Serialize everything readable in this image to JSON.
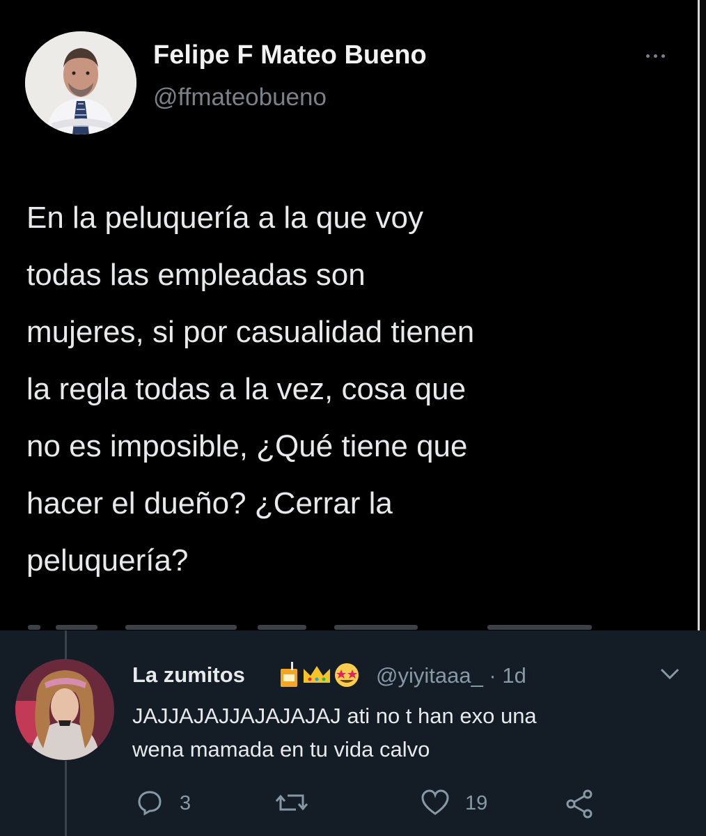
{
  "tweet": {
    "author_name": "Felipe F Mateo Bueno",
    "author_handle": "@ffmateobueno",
    "text_lines": [
      "En la peluquería a la que voy",
      "todas las empleadas son",
      "mujeres, si por casualidad tienen",
      "la regla todas a la vez, cosa que",
      "no es imposible, ¿Qué tiene que",
      "hacer el dueño? ¿Cerrar la",
      "peluquería?"
    ],
    "more_icon": "more-dots-icon"
  },
  "reply": {
    "author_name": "La zumitos",
    "name_emojis": [
      "juice-box-emoji",
      "crown-emoji",
      "star-struck-emoji"
    ],
    "handle_time": "@yiyitaaa_ · 1d",
    "text_lines": [
      "JAJJAJAJJAJAJAJAJ ati no t han exo una",
      "wena mamada en tu vida calvo"
    ],
    "actions": {
      "reply_count": "3",
      "retweet_count": "",
      "like_count": "19"
    }
  },
  "colors": {
    "top_background": "#000000",
    "reply_background": "#141d26",
    "secondary_text": "#8899a6"
  }
}
